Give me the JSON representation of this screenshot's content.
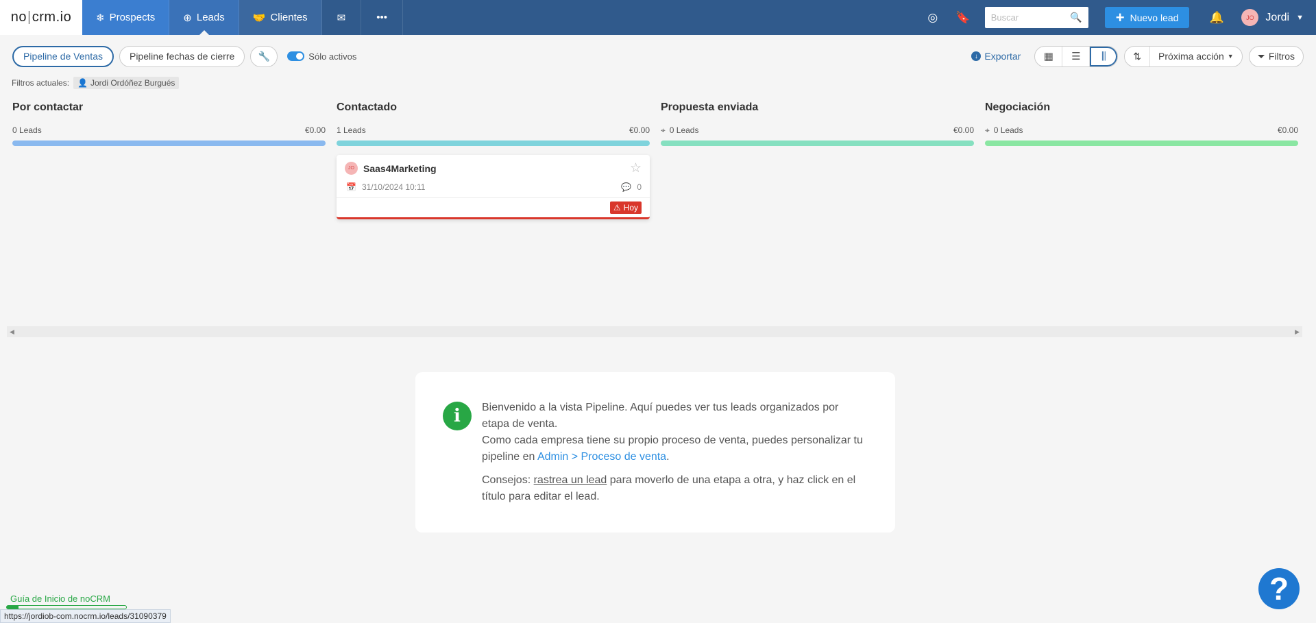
{
  "nav": {
    "logo_a": "no",
    "logo_b": "crm",
    "logo_c": ".io",
    "items": [
      {
        "label": "Prospects",
        "icon": "snowflake-icon"
      },
      {
        "label": "Leads",
        "icon": "crosshair-icon"
      },
      {
        "label": "Clientes",
        "icon": "handshake-icon"
      }
    ],
    "search_placeholder": "Buscar",
    "new_lead": "Nuevo lead",
    "user_name": "Jordi",
    "user_initials": "JO"
  },
  "toolbar": {
    "pipeline_ventas": "Pipeline de Ventas",
    "pipeline_cierre": "Pipeline fechas de cierre",
    "solo_activos": "Sólo activos",
    "exportar": "Exportar",
    "proxima_accion": "Próxima acción",
    "filtros": "Filtros"
  },
  "filters": {
    "label": "Filtros actuales:",
    "chip": "Jordi Ordóñez Burgués"
  },
  "columns": [
    {
      "title": "Por contactar",
      "leads": "0 Leads",
      "amount": "€0.00",
      "color": "#8ab9ef",
      "target": false
    },
    {
      "title": "Contactado",
      "leads": "1 Leads",
      "amount": "€0.00",
      "color": "#7fd3dc",
      "target": false
    },
    {
      "title": "Propuesta enviada",
      "leads": "0 Leads",
      "amount": "€0.00",
      "color": "#86e0c0",
      "target": true
    },
    {
      "title": "Negociación",
      "leads": "0 Leads",
      "amount": "€0.00",
      "color": "#8ae6a2",
      "target": true
    }
  ],
  "card": {
    "initials": "JO",
    "title": "Saas4Marketing",
    "date": "31/10/2024 10:11",
    "comments": "0",
    "badge": "Hoy"
  },
  "info": {
    "p1a": "Bienvenido a la vista Pipeline. Aquí puedes ver tus leads organizados por etapa de venta.",
    "p1b": "Como cada empresa tiene su propio proceso de venta, puedes personalizar tu pipeline en ",
    "link": "Admin > Proceso de venta",
    "p1c": ".",
    "p2a": "Consejos: ",
    "p2u": "rastrea un lead",
    "p2b": " para moverlo de una etapa a otra, y haz click en el título para editar el lead."
  },
  "guide": {
    "label": "Guía de Inicio de noCRM",
    "progress": 0.1
  },
  "status_url": "https://jordiob-com.nocrm.io/leads/31090379",
  "help_label": "?"
}
